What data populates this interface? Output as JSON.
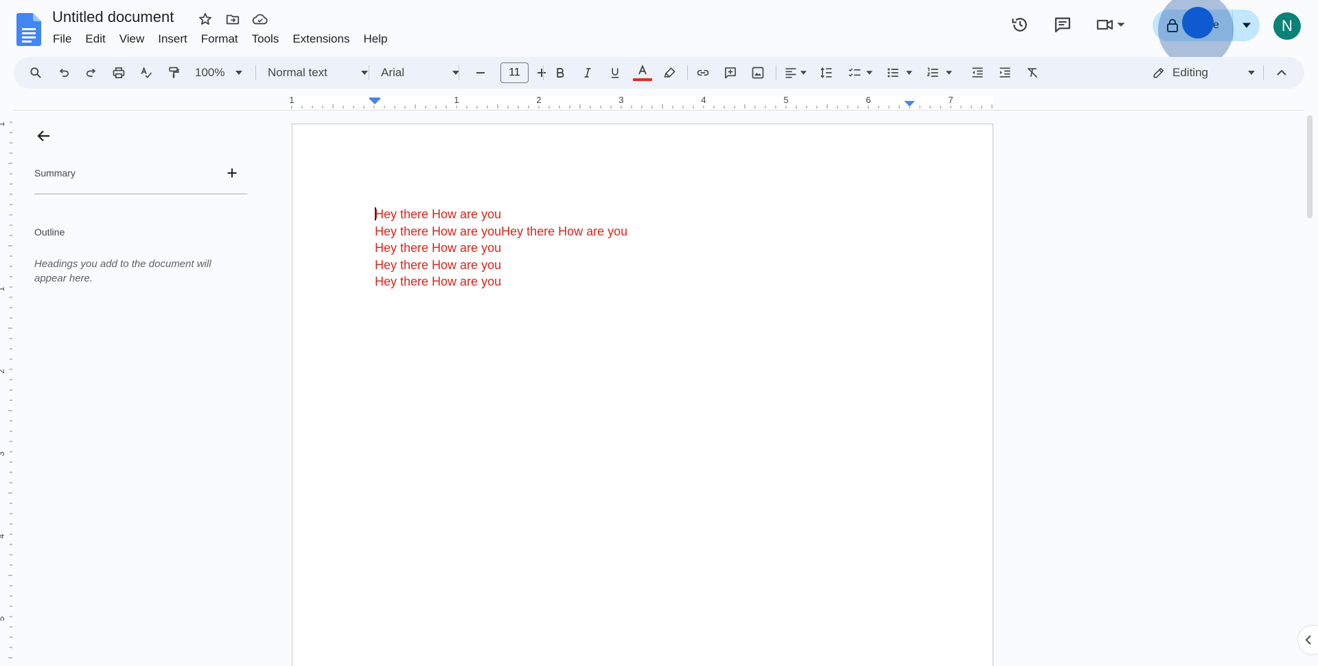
{
  "document": {
    "title": "Untitled document",
    "body_lines": [
      "Hey there How are you",
      "Hey there How are youHey there How are you",
      "Hey there How are you",
      "Hey there How are you",
      "Hey there How are you"
    ],
    "text_color": "#d9261c"
  },
  "menubar": {
    "items": [
      "File",
      "Edit",
      "View",
      "Insert",
      "Format",
      "Tools",
      "Extensions",
      "Help"
    ]
  },
  "header": {
    "share_label": "e",
    "avatar_initial": "N",
    "share_color": "#c2e7ff",
    "avatar_color": "#0b8277"
  },
  "toolbar": {
    "zoom": "100%",
    "style": "Normal text",
    "font": "Arial",
    "font_size": "11",
    "mode": "Editing",
    "text_color_swatch": "#d93025"
  },
  "ruler": {
    "h_labels": [
      "1",
      "1",
      "2",
      "3",
      "4",
      "5",
      "6",
      "7"
    ],
    "v_labels": [
      "1",
      "1",
      "2",
      "3",
      "4",
      "5"
    ]
  },
  "outline_panel": {
    "summary_label": "Summary",
    "outline_label": "Outline",
    "hint": "Headings you add to the document will appear here."
  },
  "icons": {
    "docs_logo": "google-docs-logo",
    "star": "star-icon",
    "move": "move-to-folder-icon",
    "cloud": "cloud-saved-icon",
    "history": "history-icon",
    "comments": "comment-icon",
    "meet": "video-camera-icon",
    "lock": "lock-icon"
  }
}
